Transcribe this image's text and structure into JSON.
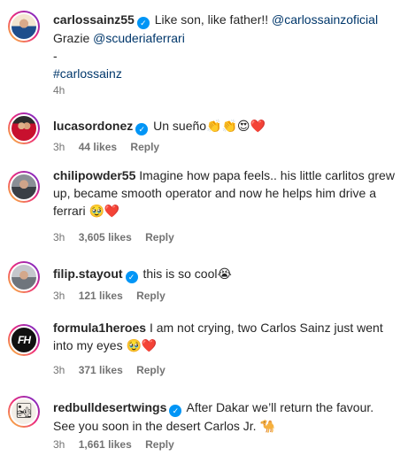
{
  "comments": [
    {
      "username": "carlossainz55",
      "verified": true,
      "caption_text": "Like son, like father!!",
      "mention1": "@carlossainzoficial",
      "grazie": "Grazie",
      "mention2": "@scuderiaferrari",
      "dash": "-",
      "hashtag": "#carlossainz",
      "time": "4h"
    },
    {
      "username": "lucasordonez",
      "verified": true,
      "text": "Un sueño👏👏😍",
      "heart": "❤️",
      "time": "3h",
      "likes": "44 likes",
      "reply": "Reply"
    },
    {
      "username": "chilipowder55",
      "verified": false,
      "text": "Imagine how papa feels.. his little carlitos grew up, became smooth operator and now he helps him drive a ferrari 🥹",
      "heart": "❤️",
      "time": "3h",
      "likes": "3,605 likes",
      "reply": "Reply"
    },
    {
      "username": "filip.stayout",
      "verified": true,
      "text": "this is so cool😭",
      "time": "3h",
      "likes": "121 likes",
      "reply": "Reply"
    },
    {
      "username": "formula1heroes",
      "verified": false,
      "avatar_text": "FH",
      "text": "I am not crying, two Carlos Sainz just went into my eyes 🥹",
      "heart": "❤️",
      "time": "3h",
      "likes": "371 likes",
      "reply": "Reply"
    },
    {
      "username": "redbulldesertwings",
      "verified": true,
      "avatar_icon": "🏜",
      "text": "After Dakar we’ll return the favour. See you soon in the desert Carlos Jr. 🐪",
      "time": "3h",
      "likes": "1,661 likes",
      "reply": "Reply"
    }
  ],
  "colors": {
    "text": "#262626",
    "link": "#00376b",
    "meta": "#737373",
    "verified": "#0095f6"
  },
  "icons": {
    "verified": "verified-badge-icon"
  }
}
